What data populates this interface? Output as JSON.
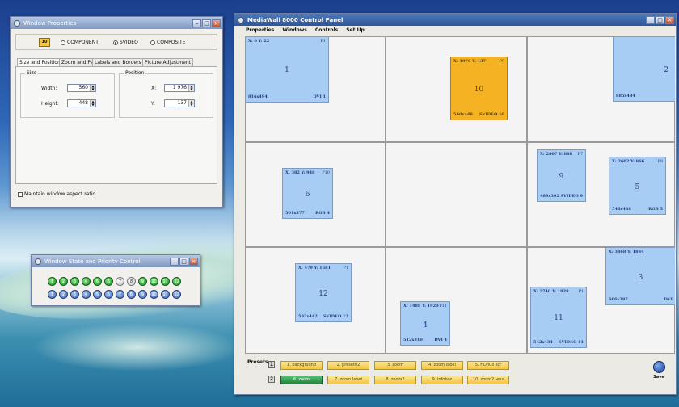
{
  "window_properties": {
    "title": "Window Properties",
    "badge": "10",
    "radios": [
      {
        "label": "COMPONENT",
        "checked": false
      },
      {
        "label": "SVIDEO",
        "checked": true
      },
      {
        "label": "COMPOSITE",
        "checked": false
      }
    ],
    "tabs": [
      "Size and Position",
      "Zoom and Pan",
      "Labels and Borders",
      "Picture Adjustment"
    ],
    "size_group": "Size",
    "position_group": "Position",
    "width_label": "Width:",
    "width_value": "560",
    "height_label": "Height:",
    "height_value": "448",
    "x_label": "X:",
    "x_value": "1 976",
    "y_label": "Y:",
    "y_value": "137",
    "aspect_label": "Maintain window aspect ratio"
  },
  "state_window": {
    "title": "Window State and Priority Control",
    "row1": [
      {
        "n": "1",
        "c": "g"
      },
      {
        "n": "2",
        "c": "g"
      },
      {
        "n": "3",
        "c": "g"
      },
      {
        "n": "4",
        "c": "g"
      },
      {
        "n": "5",
        "c": "g"
      },
      {
        "n": "6",
        "c": "g"
      },
      {
        "n": "7",
        "c": "w"
      },
      {
        "n": "8",
        "c": "w"
      },
      {
        "n": "9",
        "c": "g"
      },
      {
        "n": "10",
        "c": "g"
      },
      {
        "n": "11",
        "c": "g"
      },
      {
        "n": "12",
        "c": "g"
      }
    ],
    "row2": [
      "1",
      "2",
      "3",
      "4",
      "5",
      "6",
      "7",
      "8",
      "9",
      "10",
      "11",
      "12"
    ]
  },
  "control_panel": {
    "title": "MediaWall 8000 Control Panel",
    "menu": [
      "Properties",
      "Windows",
      "Controls",
      "Set Up"
    ],
    "windows": [
      {
        "num": "1",
        "coords": "X: 0 Y: 22",
        "tag": "P1",
        "size": "816x494",
        "src": "DVI 1",
        "sel": false
      },
      {
        "num": "10",
        "coords": "X: 1976 Y: 137",
        "tag": "P9",
        "size": "560x448",
        "src": "SVIDEO 10",
        "sel": true
      },
      {
        "num": "2",
        "coords": "",
        "tag": "",
        "size": "885x484",
        "src": "",
        "sel": false
      },
      {
        "num": "6",
        "coords": "X: 382 Y: 948",
        "tag": "P10",
        "size": "501x377",
        "src": "RGB 4",
        "sel": false
      },
      {
        "num": "9",
        "coords": "X: 2807 Y: 888",
        "tag": "P7",
        "size": "489x392",
        "src": "SVIDEO 9",
        "sel": false
      },
      {
        "num": "5",
        "coords": "X: 2602 Y: 866",
        "tag": "P8",
        "size": "546x438",
        "src": "RGB 5",
        "sel": false
      },
      {
        "num": "12",
        "coords": "X: 479 Y: 1681",
        "tag": "P1",
        "size": "592x442",
        "src": "SVIDEO 12",
        "sel": false
      },
      {
        "num": "4",
        "coords": "X: 1488 Y: 1920",
        "tag": "P11",
        "size": "512x310",
        "src": "DVI 4",
        "sel": false
      },
      {
        "num": "11",
        "coords": "X: 2740 Y: 1828",
        "tag": "P1",
        "size": "542x434",
        "src": "SVIDEO 11",
        "sel": false
      },
      {
        "num": "3",
        "coords": "X: 3468 Y: 1834",
        "tag": "",
        "size": "606x387",
        "src": "DVI",
        "sel": false
      }
    ],
    "presets_label": "Presets",
    "preset_idx": [
      "1",
      "2"
    ],
    "presets_row1": [
      "1. background",
      "2. preset02",
      "3. zoom",
      "4. zoom label",
      "5. HD full scr"
    ],
    "presets_row2": [
      "6. zoom",
      "7. zoom label",
      "8. zoom2",
      "9. infobox",
      "10. zoom2 lens"
    ],
    "save_label": "Save"
  }
}
